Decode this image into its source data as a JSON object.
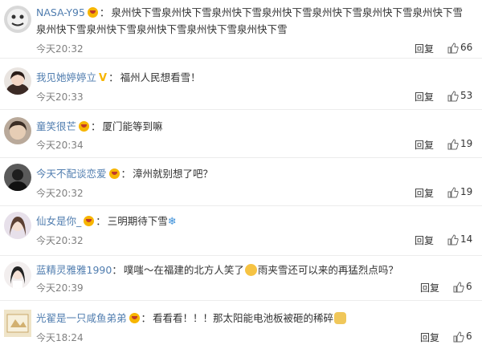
{
  "comments": [
    {
      "user": "NASA-Y95",
      "sep": "：",
      "text": "泉州快下雪泉州快下雪泉州快下雪泉州快下雪泉州快下雪泉州快下雪泉州快下雪泉州快下雪泉州快下雪泉州快下雪泉州快下雪泉州快下雪",
      "time": "今天20:32",
      "reply": "回复",
      "likes": "66"
    },
    {
      "user": "我见她婷婷立",
      "sep": "：",
      "text": "福州人民想看雪！",
      "time": "今天20:33",
      "reply": "回复",
      "likes": "53"
    },
    {
      "user": "童笑很芒",
      "sep": "：",
      "text": "厦门能等到嘛",
      "time": "今天20:34",
      "reply": "回复",
      "likes": "19"
    },
    {
      "user": "今天不配谈恋爱",
      "sep": "：",
      "text": "漳州就别想了吧？",
      "time": "今天20:32",
      "reply": "回复",
      "likes": "19"
    },
    {
      "user": "仙女是你_",
      "sep": "：",
      "text": "三明期待下雪",
      "time": "今天20:32",
      "reply": "回复",
      "likes": "14"
    },
    {
      "user": "蓝精灵雅雅1990",
      "sep": "：",
      "text1": "噗嗤～在福建的北方人笑了",
      "text2": "雨夹雪还可以来的再猛烈点吗？",
      "time": "今天20:39",
      "reply": "回复",
      "likes": "6"
    },
    {
      "user": "光翟是一只咸鱼弟弟",
      "sep": "：",
      "text": "看看看！！！那太阳能电池板被砸的稀碎",
      "time": "今天18:24",
      "reply": "回复",
      "likes": "6"
    }
  ]
}
